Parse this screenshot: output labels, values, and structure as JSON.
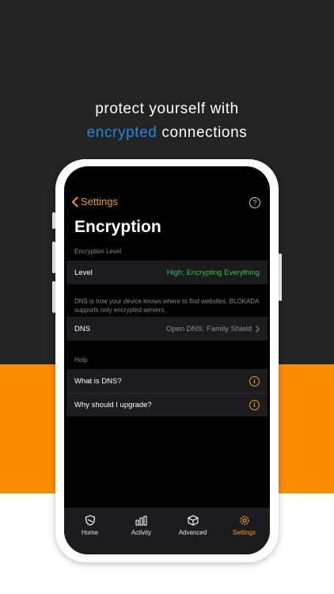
{
  "headline": {
    "line1": "protect yourself with",
    "line2_accent": "encrypted",
    "line2_rest": " connections",
    "accent_color": "#1e88e5"
  },
  "colors": {
    "orange": "#fb8c00",
    "dark": "#232323",
    "accent_orange": "#f39c12",
    "green": "#33c24d"
  },
  "nav": {
    "back_label": "Settings",
    "back_icon": "chevron-left-icon",
    "help_icon": "question-circle-icon",
    "help_glyph": "?"
  },
  "page": {
    "title": "Encryption"
  },
  "sections": {
    "level": {
      "label": "Encryption Level",
      "row_label": "Level",
      "row_value": "High: Encrypting Everything"
    },
    "dns": {
      "description": "DNS is how your device knows where to find websites. BLOKADA supports only encrypted servers.",
      "row_label": "DNS",
      "row_value": "Open DNS: Family Shield"
    },
    "help": {
      "label": "Help",
      "items": [
        {
          "label": "What is DNS?",
          "icon": "info-icon",
          "glyph": "i"
        },
        {
          "label": "Why should I upgrade?",
          "icon": "info-icon",
          "glyph": "i"
        }
      ]
    }
  },
  "tabbar": {
    "tabs": [
      {
        "label": "Home",
        "icon": "shield-icon",
        "active": false
      },
      {
        "label": "Activity",
        "icon": "bar-chart-icon",
        "active": false
      },
      {
        "label": "Advanced",
        "icon": "cube-icon",
        "active": false
      },
      {
        "label": "Settings",
        "icon": "gear-icon",
        "active": true
      }
    ]
  }
}
